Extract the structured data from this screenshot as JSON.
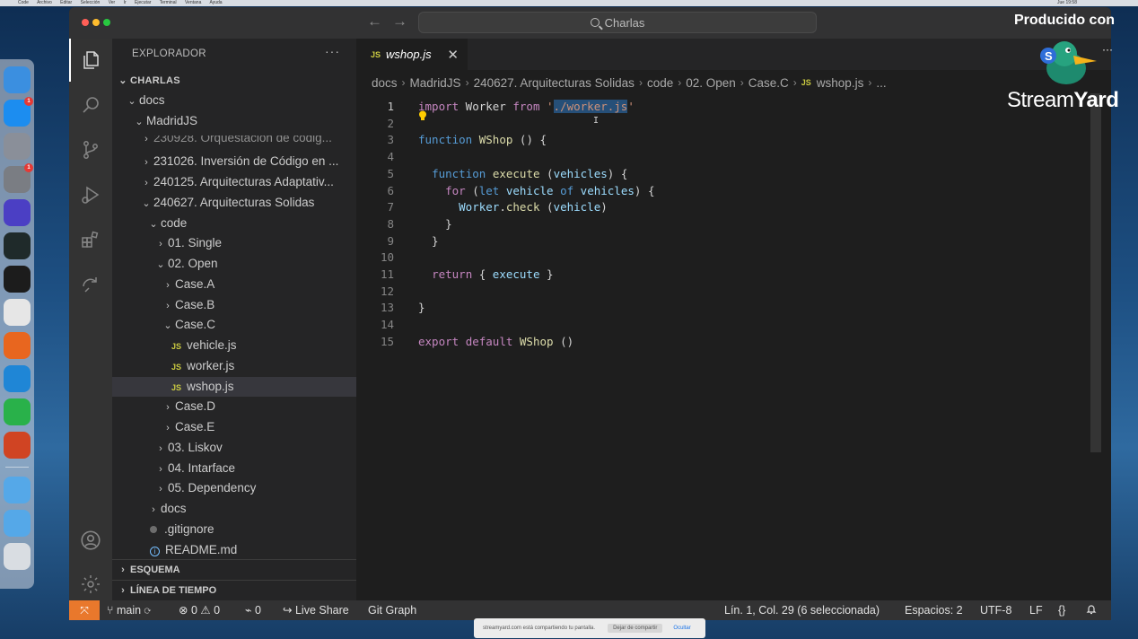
{
  "menubar": {
    "app": "Code",
    "items": [
      "Archivo",
      "Editar",
      "Selección",
      "Ver",
      "Ir",
      "Ejecutar",
      "Terminal",
      "Ventana",
      "Ayuda"
    ],
    "clock": "Jue 19:58"
  },
  "dock": {
    "apps": [
      {
        "name": "finder-icon",
        "color": "#3b8fe0"
      },
      {
        "name": "app-store-icon",
        "color": "#1c8df0",
        "badge": "1"
      },
      {
        "name": "launchpad-icon",
        "color": "#8a8f99"
      },
      {
        "name": "system-preferences-icon",
        "color": "#7a7d83",
        "badge": "1"
      },
      {
        "name": "siri-icon",
        "color": "#4b3fc4"
      },
      {
        "name": "activity-monitor-icon",
        "color": "#1f2a2a"
      },
      {
        "name": "terminal-icon",
        "color": "#1c1c1c"
      },
      {
        "name": "chrome-icon",
        "color": "#e6e6e6"
      },
      {
        "name": "firefox-icon",
        "color": "#e8661f"
      },
      {
        "name": "vscode-icon",
        "color": "#1f86d6"
      },
      {
        "name": "whatsapp-icon",
        "color": "#29b14a"
      },
      {
        "name": "powerpoint-icon",
        "color": "#d04423"
      },
      {
        "name": "folder-icon",
        "color": "#55a8e8"
      },
      {
        "name": "folder-icon",
        "color": "#55a8e8"
      },
      {
        "name": "trash-icon",
        "color": "#d9dde2"
      }
    ]
  },
  "titlebar": {
    "search_label": "Charlas"
  },
  "sidebar": {
    "title": "EXPLORADOR",
    "more": "···",
    "root": "CHARLAS",
    "tree": [
      {
        "label": "docs",
        "depth": 1,
        "kind": "folder",
        "open": true
      },
      {
        "label": "MadridJS",
        "depth": 2,
        "kind": "folder",
        "open": true
      },
      {
        "label": "230928. Orquestación de códig...",
        "depth": 3,
        "kind": "folder",
        "open": false,
        "clipped": true
      },
      {
        "label": "231026. Inversión de Código en ...",
        "depth": 3,
        "kind": "folder",
        "open": false
      },
      {
        "label": "240125. Arquitecturas Adaptativ...",
        "depth": 3,
        "kind": "folder",
        "open": false
      },
      {
        "label": "240627. Arquitecturas Solidas",
        "depth": 3,
        "kind": "folder",
        "open": true
      },
      {
        "label": "code",
        "depth": 4,
        "kind": "folder",
        "open": true
      },
      {
        "label": "01. Single",
        "depth": 5,
        "kind": "folder",
        "open": false
      },
      {
        "label": "02. Open",
        "depth": 5,
        "kind": "folder",
        "open": true
      },
      {
        "label": "Case.A",
        "depth": 6,
        "kind": "folder",
        "open": false
      },
      {
        "label": "Case.B",
        "depth": 6,
        "kind": "folder",
        "open": false
      },
      {
        "label": "Case.C",
        "depth": 6,
        "kind": "folder",
        "open": true
      },
      {
        "label": "vehicle.js",
        "depth": 7,
        "kind": "js"
      },
      {
        "label": "worker.js",
        "depth": 7,
        "kind": "js"
      },
      {
        "label": "wshop.js",
        "depth": 7,
        "kind": "js",
        "selected": true
      },
      {
        "label": "Case.D",
        "depth": 6,
        "kind": "folder",
        "open": false
      },
      {
        "label": "Case.E",
        "depth": 6,
        "kind": "folder",
        "open": false
      },
      {
        "label": "03. Liskov",
        "depth": 5,
        "kind": "folder",
        "open": false
      },
      {
        "label": "04. Intarface",
        "depth": 5,
        "kind": "folder",
        "open": false
      },
      {
        "label": "05. Dependency",
        "depth": 5,
        "kind": "folder",
        "open": false
      },
      {
        "label": "docs",
        "depth": 4,
        "kind": "folder",
        "open": false
      },
      {
        "label": ".gitignore",
        "depth": 4,
        "kind": "dot"
      },
      {
        "label": "README.md",
        "depth": 4,
        "kind": "info"
      }
    ],
    "outline_label": "ESQUEMA",
    "timeline_label": "LÍNEA DE TIEMPO"
  },
  "tab": {
    "badge": "JS",
    "name": "wshop.js",
    "close": "✕"
  },
  "breadcrumb": [
    "docs",
    "MadridJS",
    "240627. Arquitecturas Solidas",
    "code",
    "02. Open",
    "Case.C",
    "wshop.js",
    "..."
  ],
  "breadcrumb_badge": "JS",
  "editor": {
    "lines": [
      {
        "n": "1",
        "tokens": [
          [
            "kw",
            "import"
          ],
          [
            "",
            " Worker "
          ],
          [
            "kw",
            "from"
          ],
          [
            "",
            " "
          ],
          [
            "str",
            "'"
          ],
          [
            "sel-str",
            "./worker.js"
          ],
          [
            "str",
            "'"
          ]
        ]
      },
      {
        "n": "2",
        "tokens": []
      },
      {
        "n": "3",
        "tokens": [
          [
            "kw2",
            "function"
          ],
          [
            "",
            " "
          ],
          [
            "fn",
            "WShop"
          ],
          [
            "",
            " () {"
          ]
        ]
      },
      {
        "n": "4",
        "tokens": []
      },
      {
        "n": "5",
        "tokens": [
          [
            "",
            "  "
          ],
          [
            "kw2",
            "function"
          ],
          [
            "",
            " "
          ],
          [
            "fn",
            "execute"
          ],
          [
            "",
            " ("
          ],
          [
            "var",
            "vehicles"
          ],
          [
            "",
            ") {"
          ]
        ]
      },
      {
        "n": "6",
        "tokens": [
          [
            "",
            "    "
          ],
          [
            "kw",
            "for"
          ],
          [
            "",
            " ("
          ],
          [
            "kw2",
            "let"
          ],
          [
            "",
            " "
          ],
          [
            "var",
            "vehicle"
          ],
          [
            "",
            " "
          ],
          [
            "kw2",
            "of"
          ],
          [
            "",
            " "
          ],
          [
            "var",
            "vehicles"
          ],
          [
            "",
            ") {"
          ]
        ]
      },
      {
        "n": "7",
        "tokens": [
          [
            "",
            "      "
          ],
          [
            "var",
            "Worker"
          ],
          [
            "",
            "."
          ],
          [
            "fn",
            "check"
          ],
          [
            "",
            " ("
          ],
          [
            "var",
            "vehicle"
          ],
          [
            "",
            ")"
          ]
        ]
      },
      {
        "n": "8",
        "tokens": [
          [
            "",
            "    }"
          ]
        ]
      },
      {
        "n": "9",
        "tokens": [
          [
            "",
            "  }"
          ]
        ]
      },
      {
        "n": "10",
        "tokens": []
      },
      {
        "n": "11",
        "tokens": [
          [
            "",
            "  "
          ],
          [
            "kw",
            "return"
          ],
          [
            "",
            " { "
          ],
          [
            "var",
            "execute"
          ],
          [
            "",
            " }"
          ]
        ]
      },
      {
        "n": "12",
        "tokens": []
      },
      {
        "n": "13",
        "tokens": [
          [
            "",
            "}"
          ]
        ]
      },
      {
        "n": "14",
        "tokens": []
      },
      {
        "n": "15",
        "tokens": [
          [
            "kw",
            "export"
          ],
          [
            "",
            " "
          ],
          [
            "kw",
            "default"
          ],
          [
            "",
            " "
          ],
          [
            "fn",
            "WShop"
          ],
          [
            "",
            " ()"
          ]
        ]
      }
    ]
  },
  "statusbar": {
    "branch": "main",
    "errors": "0",
    "warnings": "0",
    "ports": "0",
    "live_share": "Live Share",
    "git_graph": "Git Graph",
    "position": "Lín. 1, Col. 29 (6 seleccionada)",
    "spaces": "Espacios: 2",
    "encoding": "UTF-8",
    "eol": "LF",
    "lang": "{}"
  },
  "streamyard": {
    "produced": "Producido con",
    "brand_light": "Stream",
    "brand_bold": "Yard",
    "more": "···"
  },
  "share_notice": {
    "text": "streamyard.com está compartiendo tu pantalla.",
    "stop": "Dejar de compartir",
    "hide": "Ocultar"
  }
}
